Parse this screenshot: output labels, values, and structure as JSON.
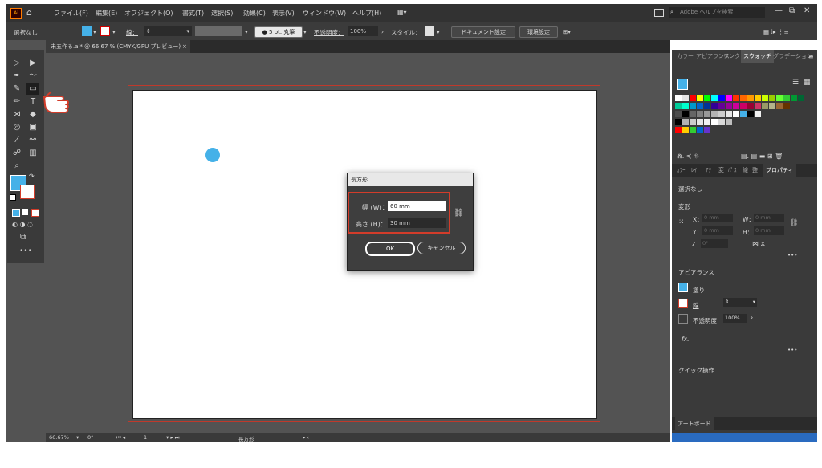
{
  "app": {
    "logo": "Ai",
    "home_icon": "home-icon"
  },
  "menu": [
    "ファイル(F)",
    "編集(E)",
    "オブジェクト(O)",
    "書式(T)",
    "選択(S)",
    "効果(C)",
    "表示(V)",
    "ウィンドウ(W)",
    "ヘルプ(H)"
  ],
  "search": {
    "placeholder": "Adobe ヘルプを検索"
  },
  "control": {
    "selection": "選択なし",
    "stroke_label": "線：",
    "brush": "5 pt. 丸筆",
    "opacity_label": "不透明度：",
    "opacity_value": "100%",
    "style_label": "スタイル：",
    "doc_settings": "ドキュメント設定",
    "prefs": "環境設定"
  },
  "doc_tab": {
    "label": "未五作る.ai* @ 66.67 % (CMYK/GPU プレビュー)",
    "close": "×"
  },
  "status": {
    "zoom": "66.67%",
    "rotate": "0°",
    "page": "1",
    "tool": "長方形"
  },
  "dialog": {
    "title": "長方形",
    "width_label": "幅 (W)：",
    "width_value": "60 mm",
    "height_label": "高さ (H)：",
    "height_value": "30 mm",
    "ok": "OK",
    "cancel": "キャンセル"
  },
  "panel": {
    "tabs_top": [
      "カラー",
      "アピアランス",
      "リンク",
      "スウォッチ",
      "グラデーション"
    ],
    "tabs_mid": [
      "ｶﾗｰ",
      "ﾚｲ",
      "ｱｸ",
      "変",
      "ﾊﾟｽ",
      "線",
      "整",
      "プロパティ"
    ],
    "selection": "選択なし",
    "transform": "変形",
    "x_label": "X：",
    "x_value": "0 mm",
    "y_label": "Y：",
    "y_value": "0 mm",
    "w_label": "W：",
    "w_value": "0 mm",
    "h_label": "H：",
    "h_value": "0 mm",
    "angle": "0°",
    "appearance": "アピアランス",
    "fill": "塗り",
    "stroke": "線",
    "opacity": "不透明度",
    "opacity_value": "100%",
    "fx": "fx.",
    "quick": "クイック操作",
    "artboards": "アートボード"
  },
  "colors": {
    "accent": "#45b1e8",
    "bg": "#535353",
    "panel": "#3a3a3a",
    "highlight": "#d23c2a"
  },
  "swatch_rows": [
    [
      "#ffffff",
      "#e6e6e6",
      "#ff0000",
      "#ffff00",
      "#00ff00",
      "#00ffff",
      "#0000ff",
      "#ff00ff",
      "#ff3300",
      "#ff6600",
      "#ff9900",
      "#ffcc00",
      "#ccff00",
      "#99cc00",
      "#66ff33",
      "#33cc33",
      "#009933",
      "#006633"
    ],
    [
      "#00cc99",
      "#00ffcc",
      "#0099cc",
      "#0066cc",
      "#003399",
      "#330099",
      "#660099",
      "#990099",
      "#cc0099",
      "#cc0066",
      "#990033",
      "#cc3366",
      "#999966",
      "#b3b38a",
      "#996633",
      "#663300"
    ],
    [
      "#4d4d4d",
      "#000000",
      "#666666",
      "#808080",
      "#999999",
      "#b3b3b3",
      "#cccccc",
      "#e6e6e6",
      "#ffffff",
      "#45b1e8",
      "#000000",
      "#f2f2f2"
    ],
    [
      "#000000",
      "#b3b3b3",
      "#cccccc",
      "#e6e6e6",
      "#f2f2f2",
      "#ffffff",
      "#d9d9d9",
      "#bfbfbf"
    ],
    [
      "#ff0000",
      "#ffcc00",
      "#33cc33",
      "#0066cc",
      "#6633cc"
    ]
  ]
}
